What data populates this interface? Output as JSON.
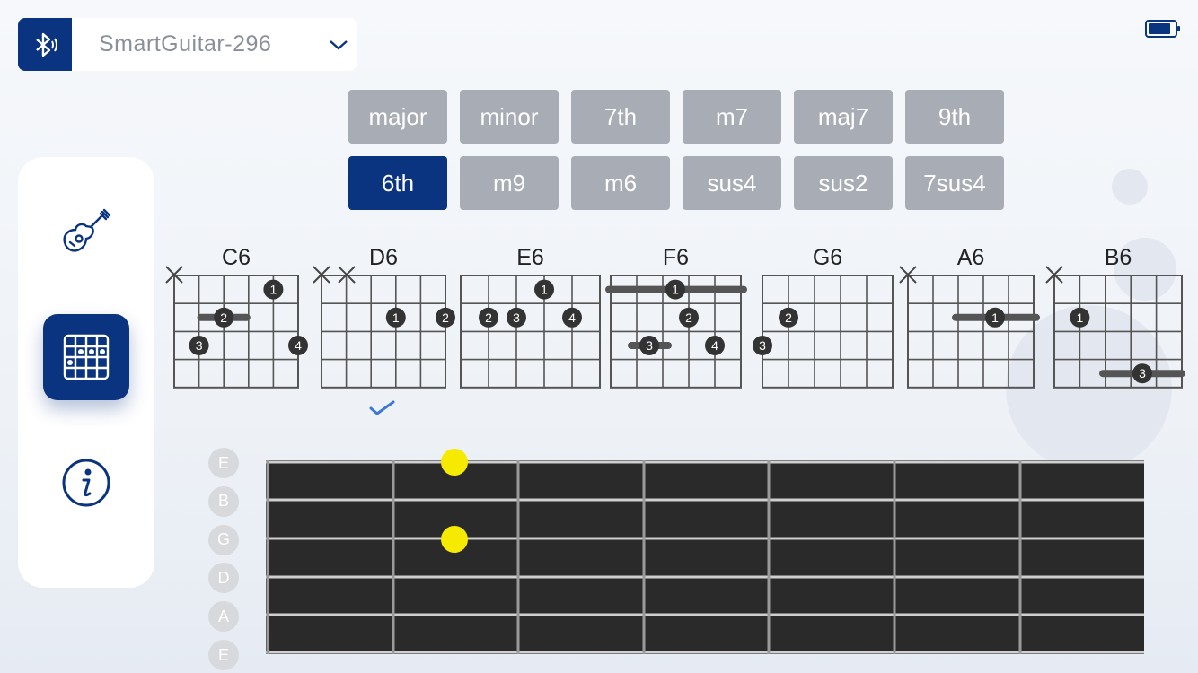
{
  "device": {
    "name": "SmartGuitar-296"
  },
  "chord_types": [
    "major",
    "minor",
    "7th",
    "m7",
    "maj7",
    "9th",
    "6th",
    "m9",
    "m6",
    "sus4",
    "sus2",
    "7sus4"
  ],
  "active_chord_type": "6th",
  "chords": [
    {
      "name": "C6"
    },
    {
      "name": "D6",
      "selected": true
    },
    {
      "name": "E6"
    },
    {
      "name": "F6"
    },
    {
      "name": "G6"
    },
    {
      "name": "A6"
    },
    {
      "name": "B6"
    }
  ],
  "strings": [
    "E",
    "B",
    "G",
    "D",
    "A",
    "E"
  ],
  "highlight_color": "#f5ea00",
  "accent_color": "#0a3380",
  "icons": [
    "bluetooth-icon",
    "chevron-down-icon",
    "battery-icon",
    "guitar-icon",
    "chord-grid-icon",
    "info-icon",
    "checkmark-icon"
  ]
}
